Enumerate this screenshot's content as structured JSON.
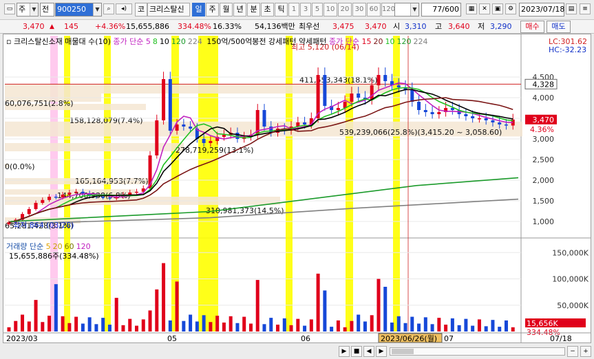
{
  "toolbar": {
    "market_label": "주",
    "prev_label": "전",
    "code": "900250",
    "code_button": "코",
    "stock_name": "크리스탈신",
    "periods": [
      {
        "label": "일",
        "selected": true
      },
      {
        "label": "주",
        "selected": false
      },
      {
        "label": "월",
        "selected": false
      },
      {
        "label": "년",
        "selected": false
      },
      {
        "label": "분",
        "selected": false
      },
      {
        "label": "초",
        "selected": false
      },
      {
        "label": "틱",
        "selected": false
      }
    ],
    "intervals": [
      "1",
      "3",
      "5",
      "10",
      "20",
      "30",
      "60",
      "120"
    ],
    "count": "77",
    "count_total": "/600",
    "date": "2023/07/18"
  },
  "quote": {
    "price": "3,470",
    "change": "145",
    "change_pct": "+4.36%",
    "volume": "15,655,886",
    "vol_ratio": "334.48%",
    "turnover_pct": "16.33%",
    "amount": "54,136백만",
    "broker": "최우선",
    "ask": "3,475",
    "bid": "3,470",
    "open_label": "시",
    "open": "3,310",
    "high_label": "고",
    "high": "3,640",
    "low_label": "저",
    "low": "3,290",
    "buy_label": "매수",
    "sell_label": "매도"
  },
  "price_legend": {
    "item1": "크리스탈신소재 매물대 수(10)",
    "item2": "종가 단순",
    "ma_a": [
      "5",
      "8",
      "10",
      "120",
      "224"
    ],
    "item3": "150억/500억봉전 강세패턴",
    "item4": "약세패턴",
    "item5": "종가 단순",
    "ma_b": [
      "15",
      "20",
      "10",
      "120",
      "224"
    ]
  },
  "price_annotations": {
    "high": "최고 5,120 (06/14)",
    "low": "최저 864 (03/28)",
    "lc": "LC:301.62",
    "hc": "HC:-32.23",
    "last_price": "3,470",
    "last_pct": "4.36%",
    "cursor_price": "4,328"
  },
  "volume_profile": [
    "411,553,343(18.1%)",
    "60,076,751(2.8%)",
    "158,128,079(7.4%)",
    "539,239,066(25.8%)(3,415.20 ~ 3,058.60)",
    "278,719,259(13.1%)",
    "0(0.0%)",
    "165,164,953(7.7%)",
    "144,700,938(6.8%)",
    "310,981,373(14.5%)",
    "65,281,428(3.1%)"
  ],
  "price_axis": [
    "4,500",
    "4,000",
    "3,500",
    "3,000",
    "2,500",
    "2,000",
    "1,500",
    "1,000"
  ],
  "volume_legend": {
    "title": "거래량 단순",
    "periods": [
      "5",
      "20",
      "60",
      "120"
    ],
    "value": "15,655,886주(334.48%)"
  },
  "volume_axis": [
    "150,000K",
    "100,000K",
    "50,000K"
  ],
  "volume_last": "15,656K",
  "volume_last_pct": "334.48%",
  "date_axis": [
    "2023/03",
    "05",
    "06",
    "07",
    "07/18"
  ],
  "cursor_date": "2023/06/26(월)",
  "colors": {
    "up": "#e0001b",
    "down": "#1648d8",
    "ma5": "#c020c0",
    "ma8": "#20c020",
    "ma10": "#000000",
    "ma20": "#7a1414",
    "ma120": "#1a9a2a",
    "ma224": "#808080",
    "highlight": "#ffff00",
    "profile": "#f5e6d2"
  },
  "chart_data": {
    "type": "candlestick",
    "series": [
      {
        "name": "종가",
        "values": [
          980,
          1040,
          1180,
          1300,
          1450,
          1520,
          1600,
          1580,
          1650,
          1700,
          1720,
          1680,
          1620,
          1600,
          1580,
          1560,
          1600,
          1650,
          1700,
          1720,
          1800,
          2600,
          3450,
          4450,
          3200,
          3350,
          3300,
          3250,
          3000,
          2900,
          2950,
          3050,
          3100,
          3150,
          3000,
          3050,
          3100,
          3700,
          3300,
          3150,
          3250,
          3200,
          3300,
          3400,
          3350,
          3500,
          4550,
          3800,
          3700,
          3750,
          3900,
          4100,
          4000,
          3950,
          4300,
          4550,
          4400,
          4300,
          4250,
          4200,
          3900,
          3700,
          3650,
          3600,
          3650,
          3750,
          3700,
          3600,
          3550,
          3500,
          3500,
          3450,
          3400,
          3350,
          3325,
          3470
        ]
      }
    ],
    "ylim": [
      700,
      5300
    ]
  }
}
